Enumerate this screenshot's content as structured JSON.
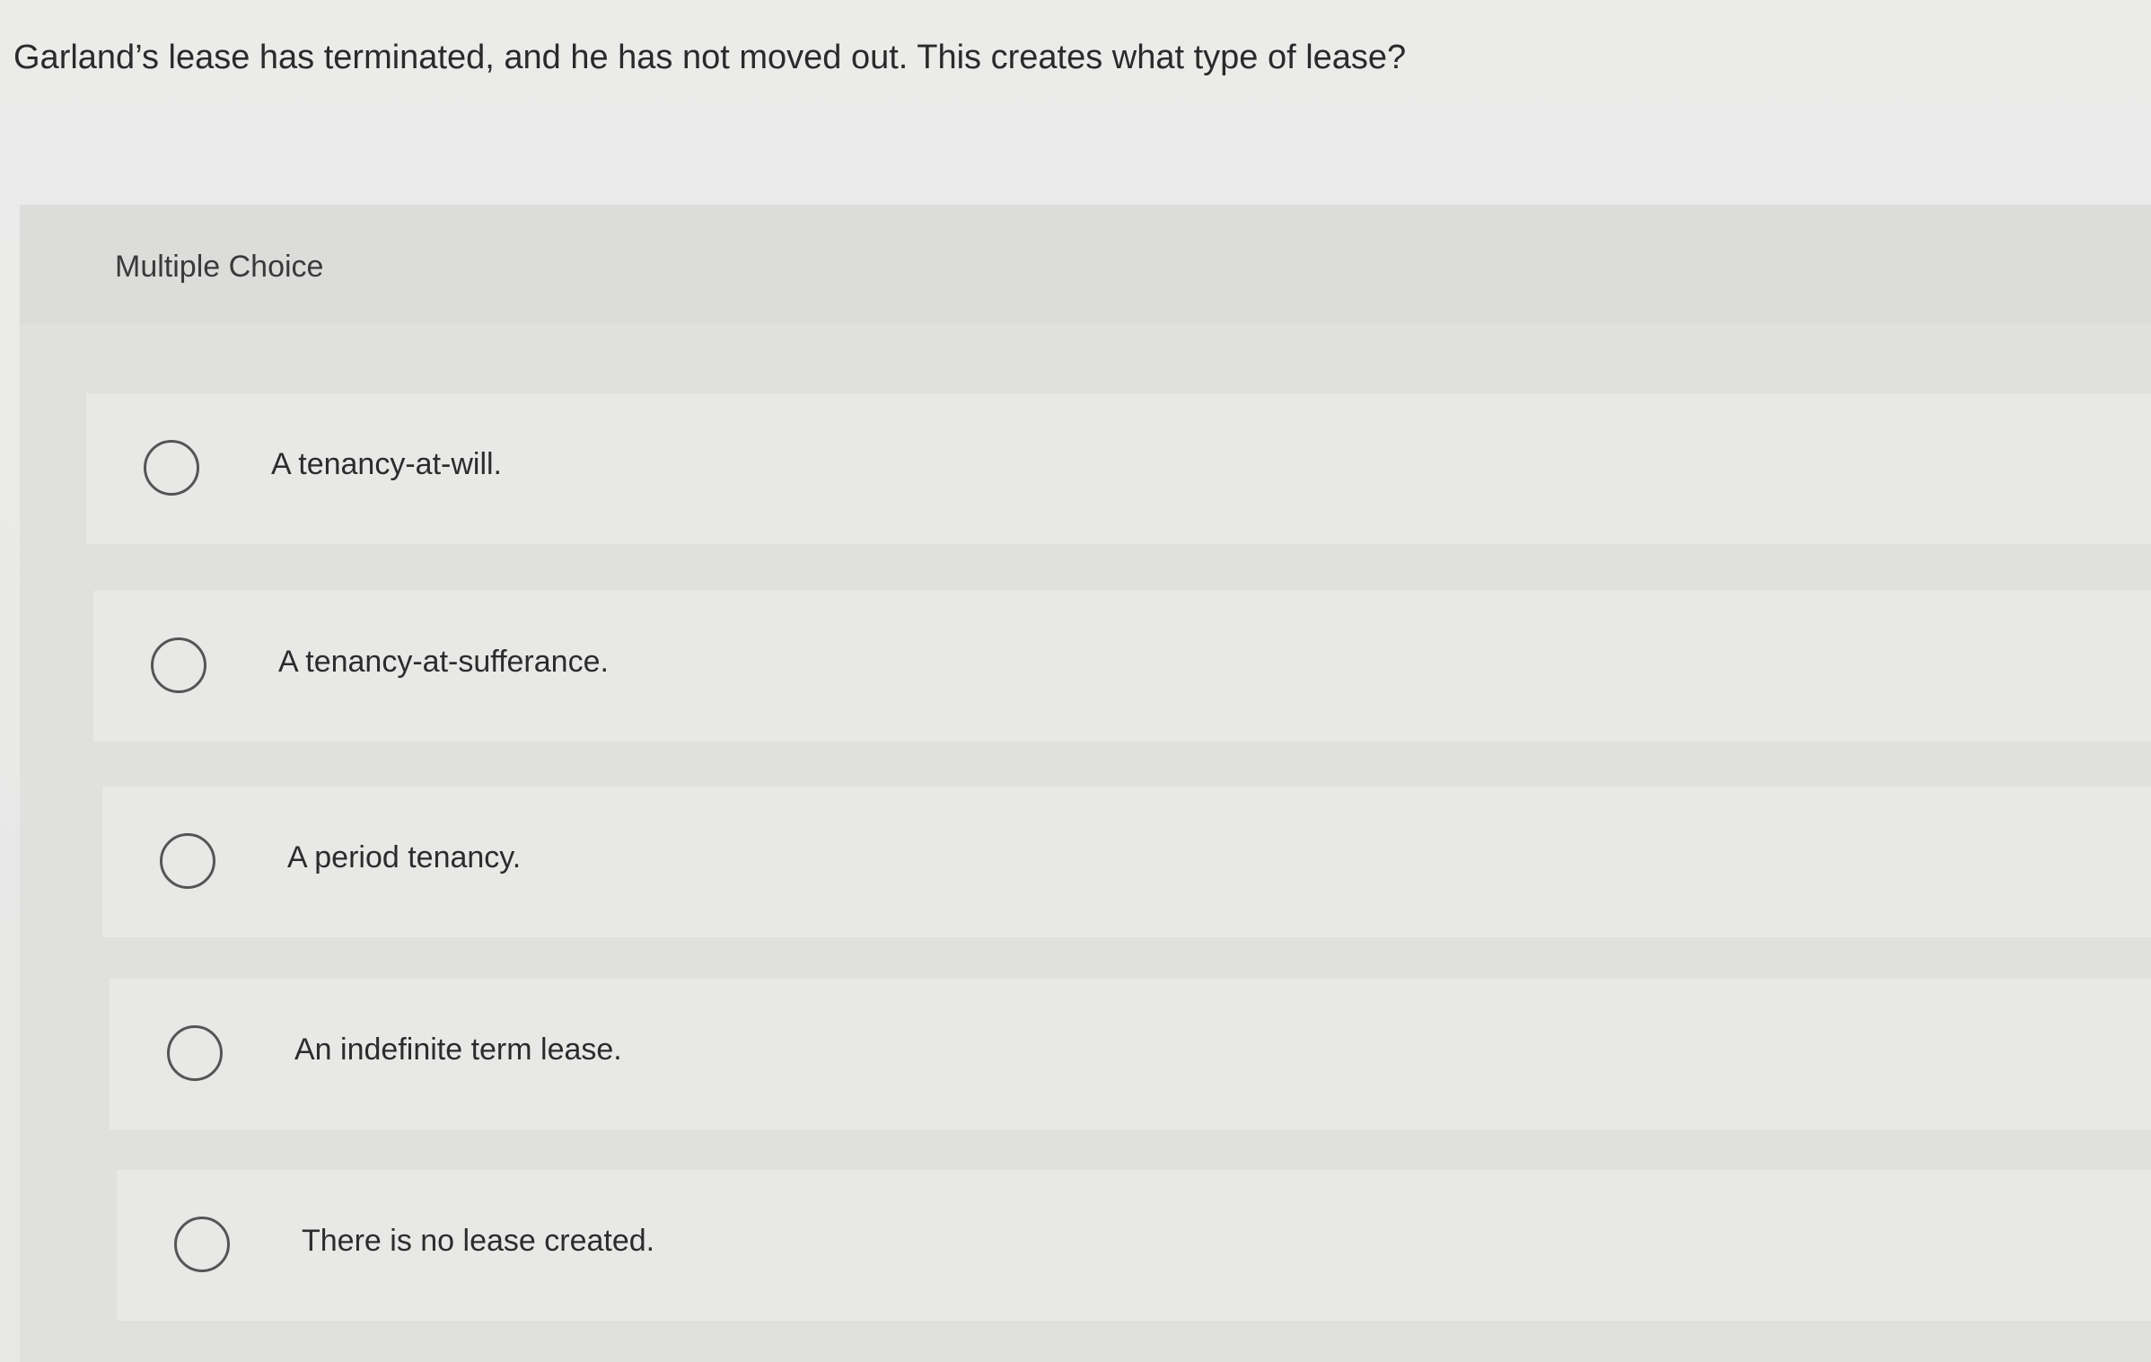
{
  "question": {
    "text": "Garland’s lease has terminated, and he has not moved out. This creates what type of lease?"
  },
  "panel": {
    "title": "Multiple Choice"
  },
  "choices": [
    {
      "label": "A tenancy-at-will."
    },
    {
      "label": "A tenancy-at-sufferance."
    },
    {
      "label": "A period tenancy."
    },
    {
      "label": "An indefinite term lease."
    },
    {
      "label": "There is no lease created."
    }
  ]
}
